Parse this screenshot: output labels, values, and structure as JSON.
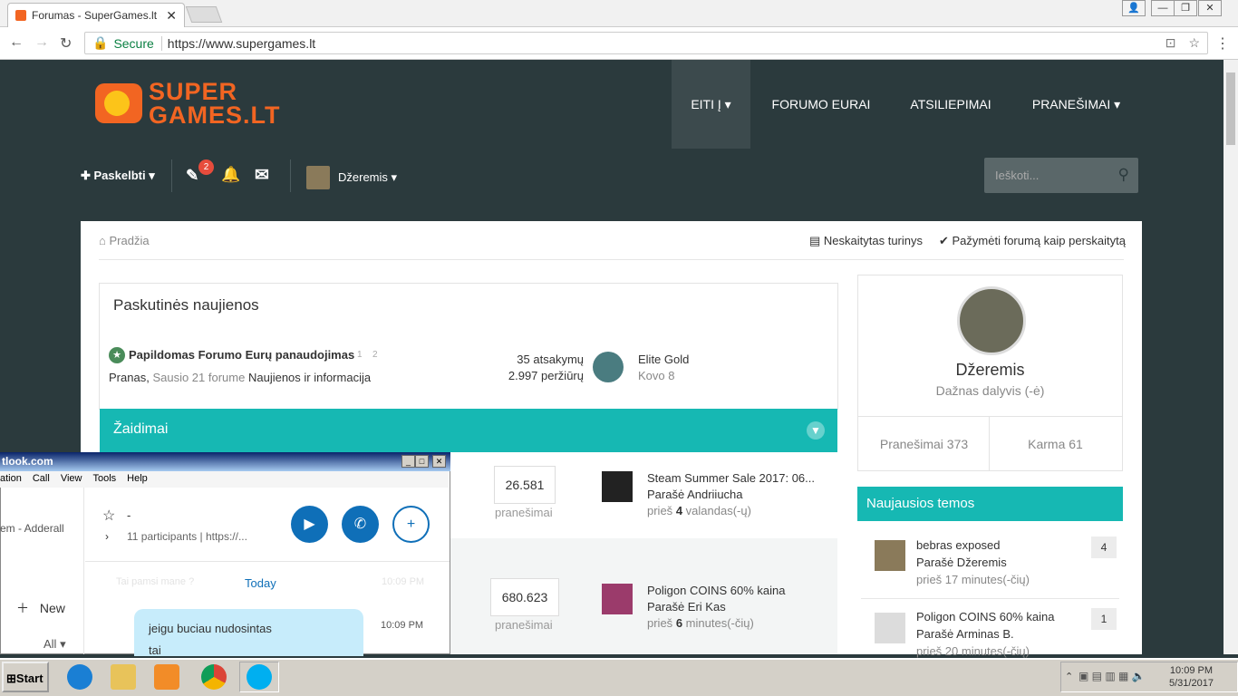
{
  "browser": {
    "tab_title": "Forumas - SuperGames.lt - ",
    "secure_label": "Secure",
    "url": "https://www.supergames.lt"
  },
  "site": {
    "logo_line1": "SUPER",
    "logo_line2a": "GAMES",
    "logo_line2b": ".LT",
    "nav": [
      "EITI Į",
      "FORUMO EURAI",
      "ATSILIEPIMAI",
      "PRANEŠIMAI"
    ],
    "post_btn": "Paskelbti",
    "notif_count": "2",
    "user": "Džeremis",
    "search_placeholder": "Ieškoti..."
  },
  "page": {
    "breadcrumb": "Pradžia",
    "unread": "Neskaitytas turinys",
    "mark_read": "Pažymėti forumą kaip perskaitytą",
    "news_title": "Paskutinės naujienos",
    "news_topic": {
      "title": "Papildomas Forumo Eurų panaudojimas",
      "pages": [
        "1",
        "2"
      ],
      "author": "Pranas,",
      "date_in": "Sausio 21 forume",
      "forum": "Naujienos ir informacija",
      "replies": "35 atsakymų",
      "views": "2.997 peržiūrų",
      "last_user": "Elite Gold",
      "last_date": "Kovo 8"
    },
    "section": "Žaidimai",
    "forums": [
      {
        "count": "26.581",
        "label": "pranešimai",
        "topic": "Steam Summer Sale 2017: 06...",
        "by": "Parašė Andriiucha",
        "when_pre": "prieš",
        "when_num": "4",
        "when_post": "valandas(-ų)"
      },
      {
        "count": "680.623",
        "label": "pranešimai",
        "topic": "Poligon COINS 60% kaina",
        "by": "Parašė Eri Kas",
        "when_pre": "prieš",
        "when_num": "6",
        "when_post": "minutes(-čių)"
      }
    ]
  },
  "sidebar": {
    "name": "Džeremis",
    "role": "Dažnas dalyvis (-ė)",
    "posts": "Pranešimai 373",
    "karma": "Karma 61",
    "new_topics_title": "Naujausios temos",
    "topics": [
      {
        "title": "bebras exposed",
        "by": "Parašė Džeremis",
        "when": "prieš 17 minutes(-čių)",
        "count": "4"
      },
      {
        "title": "Poligon COINS 60% kaina",
        "by": "Parašė Arminas B.",
        "when": "prieš 20 minutes(-čių)",
        "count": "1"
      }
    ]
  },
  "skype": {
    "title": "tlook.com",
    "menu": [
      "ation",
      "Call",
      "View",
      "Tools",
      "Help"
    ],
    "left_item": "em - Adderall",
    "new_label": "New",
    "all_label": "All",
    "chat_name": "-",
    "participants": "11 participants",
    "link": "https://...",
    "today": "Today",
    "faded_msg": "Tai pamsi mane ?",
    "faded_time": "10:09 PM",
    "msg_line1": "jeigu buciau nudosintas",
    "msg_line2": "tai",
    "msg_time": "10:09 PM"
  },
  "taskbar": {
    "start": "Start",
    "time": "10:09 PM",
    "date": "5/31/2017"
  }
}
